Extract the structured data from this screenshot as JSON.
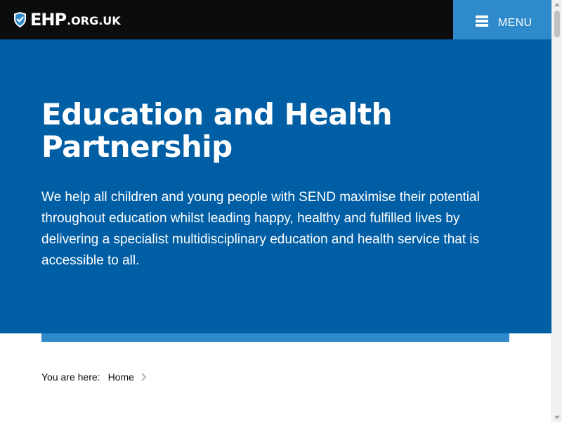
{
  "header": {
    "logo_main": "EHP",
    "logo_suffix": ".ORG.UK",
    "logo_icon": "shield-check-icon",
    "menu_label": "MENU",
    "menu_icon": "hamburger-icon"
  },
  "hero": {
    "title": "Education and Health Partnership",
    "intro": "We help all children and young people with SEND maximise their potential throughout education whilst leading happy, healthy and fulfilled lives by delivering a specialist multidisciplinary education and health service that is accessible to all."
  },
  "breadcrumb": {
    "label": "You are here:",
    "items": [
      {
        "label": "Home"
      }
    ],
    "separator_icon": "chevron-right-icon"
  },
  "colors": {
    "header_bg": "#0b0c0c",
    "menu_bg": "#2e8aca",
    "hero_bg": "#005ea5",
    "accent_bar": "#2e8aca",
    "text_dark": "#0b0c0c"
  }
}
